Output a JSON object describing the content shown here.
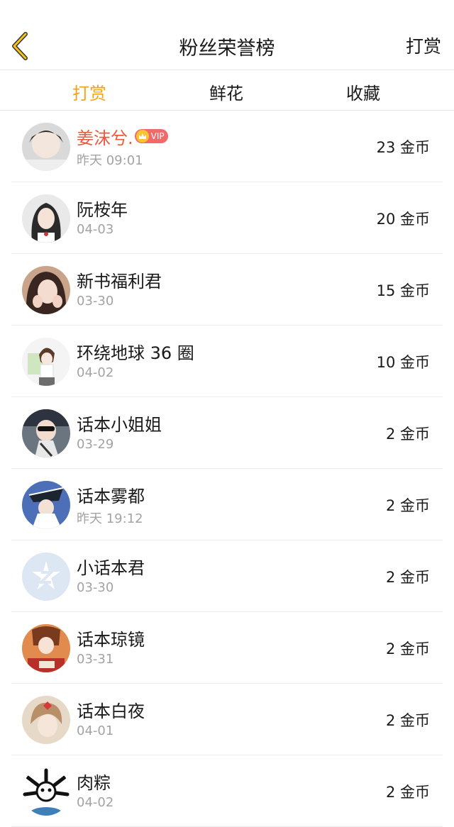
{
  "header": {
    "title": "粉丝荣誉榜",
    "action_label": "打赏",
    "back_icon": "chevron-left-icon",
    "accent_color": "#f4a21b"
  },
  "tabs": [
    {
      "label": "打赏",
      "active": true
    },
    {
      "label": "鲜花",
      "active": false
    },
    {
      "label": "收藏",
      "active": false
    }
  ],
  "fans": [
    {
      "name": "姜沫兮.",
      "vip": true,
      "vip_label": "VIP",
      "time": "昨天 09:01",
      "amount": "23 金币"
    },
    {
      "name": "阮桉年",
      "vip": false,
      "time": "04-03",
      "amount": "20 金币"
    },
    {
      "name": "新书福利君",
      "vip": false,
      "time": "03-30",
      "amount": "15 金币"
    },
    {
      "name": "环绕地球 36 圈",
      "vip": false,
      "time": "04-02",
      "amount": "10 金币"
    },
    {
      "name": "话本小姐姐",
      "vip": false,
      "time": "03-29",
      "amount": "2 金币"
    },
    {
      "name": "话本雾都",
      "vip": false,
      "time": "昨天 19:12",
      "amount": "2 金币"
    },
    {
      "name": "小话本君",
      "vip": false,
      "time": "03-30",
      "amount": "2 金币"
    },
    {
      "name": "话本琼镜",
      "vip": false,
      "time": "03-31",
      "amount": "2 金币"
    },
    {
      "name": "话本白夜",
      "vip": false,
      "time": "04-01",
      "amount": "2 金币"
    },
    {
      "name": "肉粽",
      "vip": false,
      "time": "04-02",
      "amount": "2 金币"
    }
  ]
}
